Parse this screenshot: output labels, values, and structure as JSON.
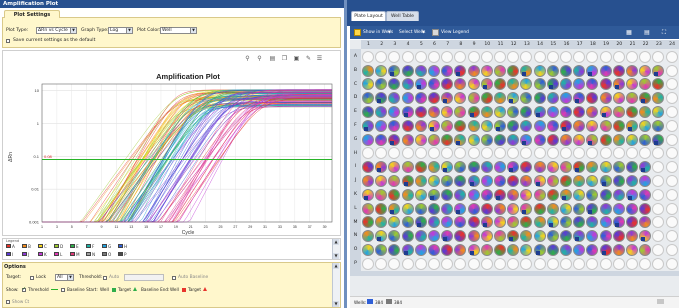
{
  "left_panel": {
    "title": "Amplification Plot",
    "settings": {
      "tab_label": "Plot Settings",
      "plot_type_label": "Plot Type:",
      "plot_type_value": "ΔRn vs Cycle",
      "graph_type_label": "Graph Type:",
      "graph_type_value": "Log",
      "plot_color_label": "Plot Color:",
      "plot_color_value": "Well",
      "save_default_label": "Save current settings as the default"
    },
    "chart": {
      "title": "Amplification Plot",
      "ylabel": "ΔRn",
      "xlabel": "Cycle",
      "y_ticks": [
        "10",
        "1",
        "0.1",
        "0.01",
        "0.001"
      ],
      "x_ticks": [
        "1",
        "3",
        "5",
        "7",
        "9",
        "11",
        "13",
        "15",
        "17",
        "19",
        "21",
        "23",
        "25",
        "27",
        "29",
        "31",
        "33",
        "35",
        "37",
        "39"
      ],
      "threshold_label": "0.08"
    },
    "legend": {
      "caption": "Legend",
      "row1": [
        {
          "label": "A",
          "color": "#e8342c"
        },
        {
          "label": "B",
          "color": "#f28c1e"
        },
        {
          "label": "C",
          "color": "#f4d41c"
        },
        {
          "label": "D",
          "color": "#9ecb2f"
        },
        {
          "label": "E",
          "color": "#2fae4a"
        },
        {
          "label": "F",
          "color": "#1fb3a6"
        },
        {
          "label": "G",
          "color": "#22a3e0"
        },
        {
          "label": "H",
          "color": "#2f5fd6"
        }
      ],
      "row2": [
        {
          "label": "I",
          "color": "#5a3ad6"
        },
        {
          "label": "J",
          "color": "#8e3ad6"
        },
        {
          "label": "K",
          "color": "#c23ad6"
        },
        {
          "label": "L",
          "color": "#e03ab3"
        },
        {
          "label": "M",
          "color": "#e03a78"
        },
        {
          "label": "N",
          "color": "#a0a0a0"
        },
        {
          "label": "O",
          "color": "#7a7a7a"
        },
        {
          "label": "P",
          "color": "#4a4a4a"
        }
      ]
    },
    "options": {
      "tab_label": "Options",
      "target_label": "Target:",
      "lock_label": "Lock",
      "target_value": "All",
      "threshold_label": "Threshold:",
      "auto_label": "Auto",
      "auto_baseline_label": "Auto Baseline",
      "show_label": "Show:",
      "threshold_show_label": "Threshold",
      "baseline_start_label": "Baseline Start:",
      "well_label": "Well",
      "target_chip_label": "Target",
      "baseline_end_label": "Baseline End:",
      "show_ct_label": "Show Ct"
    }
  },
  "right_panel": {
    "tabs": [
      {
        "label": "Plate Layout"
      },
      {
        "label": "Well Table"
      }
    ],
    "toolbar": {
      "show_in_wells": "Show in Wells",
      "select_wells": "Select Wells",
      "view_legend": "View Legend"
    },
    "columns": [
      "1",
      "2",
      "3",
      "4",
      "5",
      "6",
      "7",
      "8",
      "9",
      "10",
      "11",
      "12",
      "13",
      "14",
      "15",
      "16",
      "17",
      "18",
      "19",
      "20",
      "21",
      "22",
      "23",
      "24"
    ],
    "rows": [
      "A",
      "B",
      "C",
      "D",
      "E",
      "F",
      "G",
      "H",
      "I",
      "J",
      "K",
      "L",
      "M",
      "N",
      "O",
      "P"
    ],
    "bottom": {
      "wells_label": "Wells:",
      "count_a": "384",
      "count_b": "384"
    }
  },
  "colors": {
    "titlebar": "#27508f",
    "threshold_line": "#28b428"
  }
}
